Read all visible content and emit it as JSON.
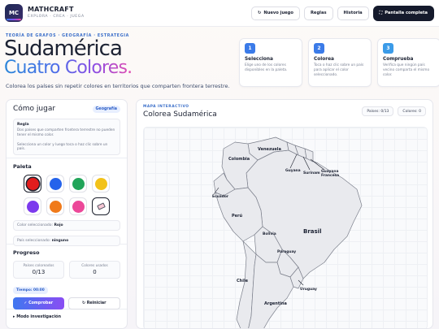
{
  "header": {
    "logo_text": "MC",
    "brand_name": "MATHCRAFT",
    "brand_tagline": "EXPLORA · CREA · JUEGA",
    "buttons": {
      "new_game": "Nuevo juego",
      "rules": "Reglas",
      "history": "Historia",
      "fullscreen": "Pantalla completa"
    }
  },
  "hero": {
    "eyebrow": "TEORÍA DE GRAFOS · GEOGRAFÍA · ESTRATEGIA",
    "title_line1": "Sudamérica",
    "title_line2": "Cuatro Colores.",
    "lead": "Colorea los países sin repetir colores en territorios que comparten frontera terrestre."
  },
  "steps": [
    {
      "num": "1",
      "title": "Selecciona",
      "text": "Elige uno de los colores disponibles en la paleta.",
      "color": "#3b7be8"
    },
    {
      "num": "2",
      "title": "Colorea",
      "text": "Toca o haz clic sobre un país para aplicar el color seleccionado.",
      "color": "#3b7be8"
    },
    {
      "num": "3",
      "title": "Comprueba",
      "text": "Verifica que ningún país vecino comparta el mismo color.",
      "color": "#3b9be8"
    }
  ],
  "howto": {
    "title": "Cómo jugar",
    "badge": "Geografía",
    "rule_label": "Regla",
    "rule_text": "Dos países que comparten frontera terrestre no pueden tener el mismo color.",
    "instruction": "Selecciona un color y luego toca o haz clic sobre un país."
  },
  "palette": {
    "title": "Paleta",
    "colors": [
      {
        "name": "rojo",
        "hex": "#e11d1d",
        "selected": true
      },
      {
        "name": "azul",
        "hex": "#2563eb",
        "selected": false
      },
      {
        "name": "verde",
        "hex": "#22a55a",
        "selected": false
      },
      {
        "name": "amarillo",
        "hex": "#f2c21a",
        "selected": false
      },
      {
        "name": "morado",
        "hex": "#7c3aed",
        "selected": false
      },
      {
        "name": "naranja",
        "hex": "#f07a1a",
        "selected": false
      },
      {
        "name": "rosa",
        "hex": "#ec4899",
        "selected": false
      }
    ],
    "eraser_icon": "eraser-icon",
    "selected_color_label": "Color seleccionado:",
    "selected_color_value": "Rojo",
    "selected_country_label": "País seleccionado:",
    "selected_country_value": "ninguno"
  },
  "progress": {
    "title": "Progreso",
    "colored_label": "Países coloreados",
    "colored_value": "0/13",
    "errors_label": "Colores usados",
    "errors_value": "0",
    "timer": "Tiempo: 00:00",
    "check_button": "✓ Comprobar",
    "reset_button": "↻ Reiniciar"
  },
  "investigation": {
    "label": "▸ Modo investigación"
  },
  "map_panel": {
    "eyebrow": "MAPA INTERACTIVO",
    "title": "Colorea Sudamérica",
    "countries_pill": "Países: 0/13",
    "colors_pill": "Colores: 0",
    "labels": {
      "venezuela": "Venezuela",
      "colombia": "Colombia",
      "guyana": "Guyana",
      "suriname": "Surinam",
      "french_guiana": "Guayana Francesa",
      "ecuador": "Ecuador",
      "peru": "Perú",
      "brazil": "Brasil",
      "bolivia": "Bolivia",
      "paraguay": "Paraguay",
      "chile": "Chile",
      "uruguay": "Uruguay",
      "argentina": "Argentina"
    }
  }
}
